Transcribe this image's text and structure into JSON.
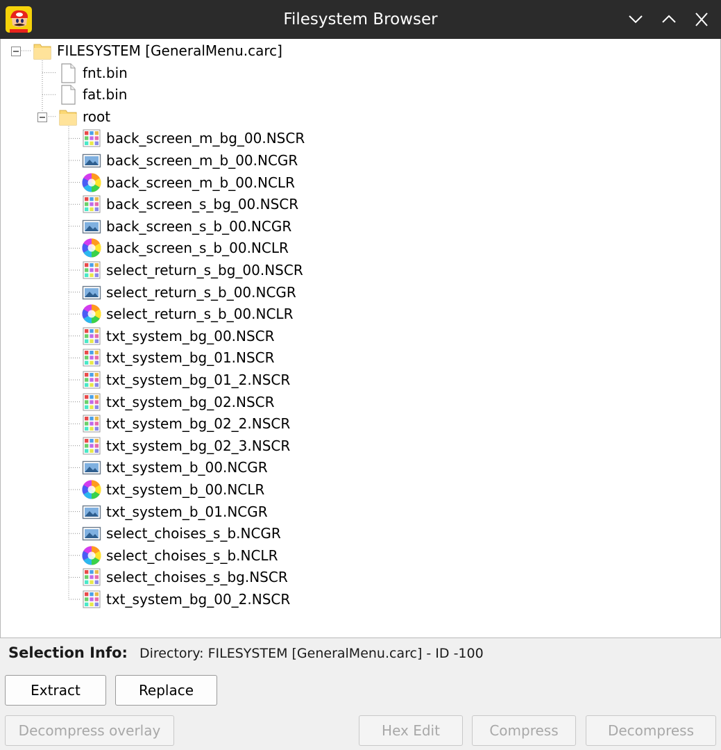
{
  "window": {
    "title": "Filesystem Browser"
  },
  "tree": {
    "nodes": [
      {
        "label": "FILESYSTEM [GeneralMenu.carc]",
        "icon": "folder-icon",
        "level": 0,
        "expander": "collapse"
      },
      {
        "label": "fnt.bin",
        "icon": "file-icon",
        "level": 1
      },
      {
        "label": "fat.bin",
        "icon": "file-icon",
        "level": 1
      },
      {
        "label": "root",
        "icon": "folder-icon",
        "level": 1,
        "expander": "collapse"
      },
      {
        "label": "back_screen_m_bg_00.NSCR",
        "icon": "screen-map-icon",
        "level": 2
      },
      {
        "label": "back_screen_m_b_00.NCGR",
        "icon": "graphics-icon",
        "level": 2
      },
      {
        "label": "back_screen_m_b_00.NCLR",
        "icon": "palette-icon",
        "level": 2
      },
      {
        "label": "back_screen_s_bg_00.NSCR",
        "icon": "screen-map-icon",
        "level": 2
      },
      {
        "label": "back_screen_s_b_00.NCGR",
        "icon": "graphics-icon",
        "level": 2
      },
      {
        "label": "back_screen_s_b_00.NCLR",
        "icon": "palette-icon",
        "level": 2
      },
      {
        "label": "select_return_s_bg_00.NSCR",
        "icon": "screen-map-icon",
        "level": 2
      },
      {
        "label": "select_return_s_b_00.NCGR",
        "icon": "graphics-icon",
        "level": 2
      },
      {
        "label": "select_return_s_b_00.NCLR",
        "icon": "palette-icon",
        "level": 2
      },
      {
        "label": "txt_system_bg_00.NSCR",
        "icon": "screen-map-icon",
        "level": 2
      },
      {
        "label": "txt_system_bg_01.NSCR",
        "icon": "screen-map-icon",
        "level": 2
      },
      {
        "label": "txt_system_bg_01_2.NSCR",
        "icon": "screen-map-icon",
        "level": 2
      },
      {
        "label": "txt_system_bg_02.NSCR",
        "icon": "screen-map-icon",
        "level": 2
      },
      {
        "label": "txt_system_bg_02_2.NSCR",
        "icon": "screen-map-icon",
        "level": 2
      },
      {
        "label": "txt_system_bg_02_3.NSCR",
        "icon": "screen-map-icon",
        "level": 2
      },
      {
        "label": "txt_system_b_00.NCGR",
        "icon": "graphics-icon",
        "level": 2
      },
      {
        "label": "txt_system_b_00.NCLR",
        "icon": "palette-icon",
        "level": 2
      },
      {
        "label": "txt_system_b_01.NCGR",
        "icon": "graphics-icon",
        "level": 2
      },
      {
        "label": "select_choises_s_b.NCGR",
        "icon": "graphics-icon",
        "level": 2
      },
      {
        "label": "select_choises_s_b.NCLR",
        "icon": "palette-icon",
        "level": 2
      },
      {
        "label": "select_choises_s_bg.NSCR",
        "icon": "screen-map-icon",
        "level": 2
      },
      {
        "label": "txt_system_bg_00_2.NSCR",
        "icon": "screen-map-icon",
        "level": 2
      }
    ]
  },
  "selection": {
    "label": "Selection Info:",
    "value": "Directory: FILESYSTEM [GeneralMenu.carc] - ID -100"
  },
  "buttons": {
    "extract": "Extract",
    "replace": "Replace",
    "decompress_overlay": "Decompress overlay",
    "hex_edit": "Hex Edit",
    "compress": "Compress",
    "decompress": "Decompress"
  },
  "colors": {
    "titlebar": "#2b2b2b",
    "folder": "#fbd874",
    "disabled_text": "#a8a8a8"
  }
}
